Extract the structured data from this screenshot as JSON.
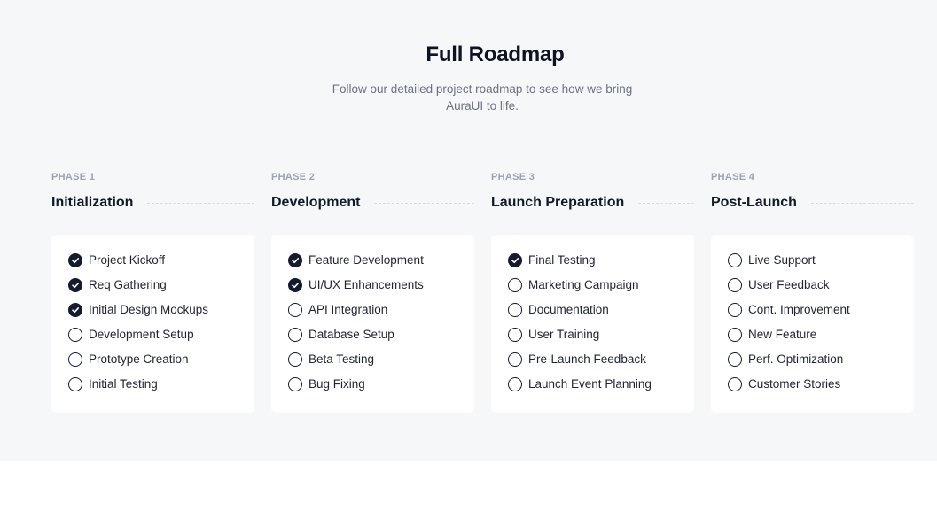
{
  "header": {
    "title": "Full Roadmap",
    "subtitle": "Follow our detailed project roadmap to see how we bring AuraUI to life."
  },
  "colors": {
    "accent": "#161a2e",
    "background": "#f6f7f9",
    "muted": "#9ca3af"
  },
  "phases": [
    {
      "label": "PHASE 1",
      "name": "Initialization",
      "items": [
        {
          "label": "Project Kickoff",
          "done": true
        },
        {
          "label": "Req Gathering",
          "done": true
        },
        {
          "label": "Initial Design Mockups",
          "done": true
        },
        {
          "label": "Development Setup",
          "done": false
        },
        {
          "label": "Prototype Creation",
          "done": false
        },
        {
          "label": "Initial Testing",
          "done": false
        }
      ]
    },
    {
      "label": "PHASE 2",
      "name": "Development",
      "items": [
        {
          "label": "Feature Development",
          "done": true
        },
        {
          "label": "UI/UX Enhancements",
          "done": true
        },
        {
          "label": "API Integration",
          "done": false
        },
        {
          "label": "Database Setup",
          "done": false
        },
        {
          "label": "Beta Testing",
          "done": false
        },
        {
          "label": "Bug Fixing",
          "done": false
        }
      ]
    },
    {
      "label": "PHASE 3",
      "name": "Launch Preparation",
      "items": [
        {
          "label": "Final Testing",
          "done": true
        },
        {
          "label": "Marketing Campaign",
          "done": false
        },
        {
          "label": "Documentation",
          "done": false
        },
        {
          "label": "User Training",
          "done": false
        },
        {
          "label": "Pre-Launch Feedback",
          "done": false
        },
        {
          "label": "Launch Event Planning",
          "done": false
        }
      ]
    },
    {
      "label": "PHASE 4",
      "name": "Post-Launch",
      "items": [
        {
          "label": "Live Support",
          "done": false
        },
        {
          "label": "User Feedback",
          "done": false
        },
        {
          "label": "Cont. Improvement",
          "done": false
        },
        {
          "label": "New Feature",
          "done": false
        },
        {
          "label": "Perf. Optimization",
          "done": false
        },
        {
          "label": "Customer Stories",
          "done": false
        }
      ]
    }
  ]
}
